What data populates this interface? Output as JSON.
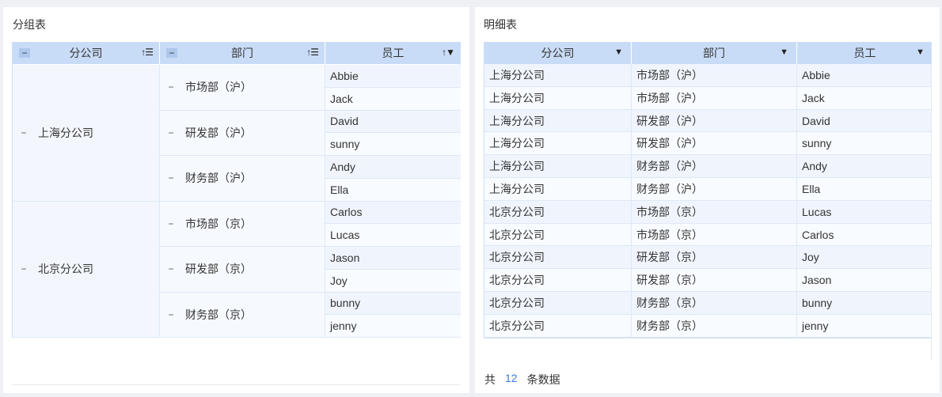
{
  "grouped": {
    "title": "分组表",
    "headers": {
      "company": "分公司",
      "dept": "部门",
      "employee": "员工"
    },
    "groups": [
      {
        "company": "上海分公司",
        "depts": [
          {
            "name": "市场部（沪）",
            "employees": [
              "Abbie",
              "Jack"
            ]
          },
          {
            "name": "研发部（沪）",
            "employees": [
              "David",
              "sunny"
            ]
          },
          {
            "name": "财务部（沪）",
            "employees": [
              "Andy",
              "Ella"
            ]
          }
        ]
      },
      {
        "company": "北京分公司",
        "depts": [
          {
            "name": "市场部（京）",
            "employees": [
              "Carlos",
              "Lucas"
            ]
          },
          {
            "name": "研发部（京）",
            "employees": [
              "Jason",
              "Joy"
            ]
          },
          {
            "name": "财务部（京）",
            "employees": [
              "bunny",
              "jenny"
            ]
          }
        ]
      }
    ]
  },
  "detail": {
    "title": "明细表",
    "headers": {
      "company": "分公司",
      "dept": "部门",
      "employee": "员工"
    },
    "rows": [
      [
        "上海分公司",
        "市场部（沪）",
        "Abbie"
      ],
      [
        "上海分公司",
        "市场部（沪）",
        "Jack"
      ],
      [
        "上海分公司",
        "研发部（沪）",
        "David"
      ],
      [
        "上海分公司",
        "研发部（沪）",
        "sunny"
      ],
      [
        "上海分公司",
        "财务部（沪）",
        "Andy"
      ],
      [
        "上海分公司",
        "财务部（沪）",
        "Ella"
      ],
      [
        "北京分公司",
        "市场部（京）",
        "Lucas"
      ],
      [
        "北京分公司",
        "市场部（京）",
        "Carlos"
      ],
      [
        "北京分公司",
        "研发部（京）",
        "Joy"
      ],
      [
        "北京分公司",
        "研发部（京）",
        "Jason"
      ],
      [
        "北京分公司",
        "财务部（京）",
        "bunny"
      ],
      [
        "北京分公司",
        "财务部（京）",
        "jenny"
      ]
    ],
    "pager": {
      "prefix": "共",
      "count": "12",
      "suffix": "条数据"
    }
  },
  "icons": {
    "collapse": "minus-icon",
    "sort": "sort-icon",
    "dropdown": "caret-down-icon",
    "filter": "filter-icon"
  }
}
